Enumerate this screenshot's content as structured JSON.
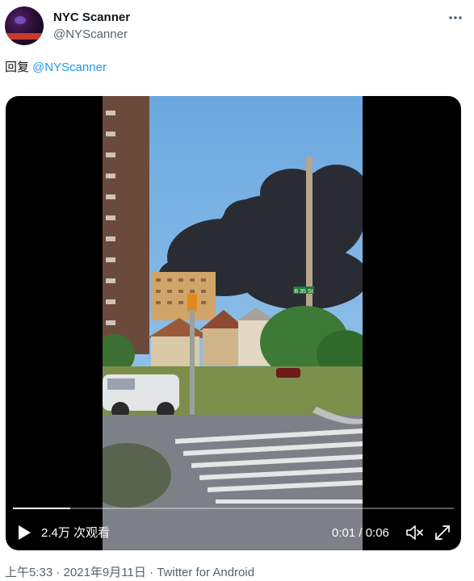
{
  "author": {
    "name": "NYC Scanner",
    "handle": "@NYScanner"
  },
  "tweet": {
    "reply_prefix": "回复",
    "reply_mention": "@NYScanner"
  },
  "video": {
    "views": "2.4万 次观看",
    "time": "0:01 / 0:06",
    "progress": 0.13
  },
  "meta": {
    "time": "上午5:33",
    "date": "2021年9月11日",
    "source": "Twitter for Android",
    "separator": "·"
  },
  "scene": {
    "street_sign": "B 35 St"
  },
  "colors": {
    "text_primary": "#0f1419",
    "text_secondary": "#536471",
    "link": "#1d9bf0",
    "video_bg": "#000000"
  },
  "icons": {
    "more": "more-icon",
    "play": "play-icon",
    "volume": "volume-muted-icon",
    "fullscreen": "fullscreen-icon"
  }
}
